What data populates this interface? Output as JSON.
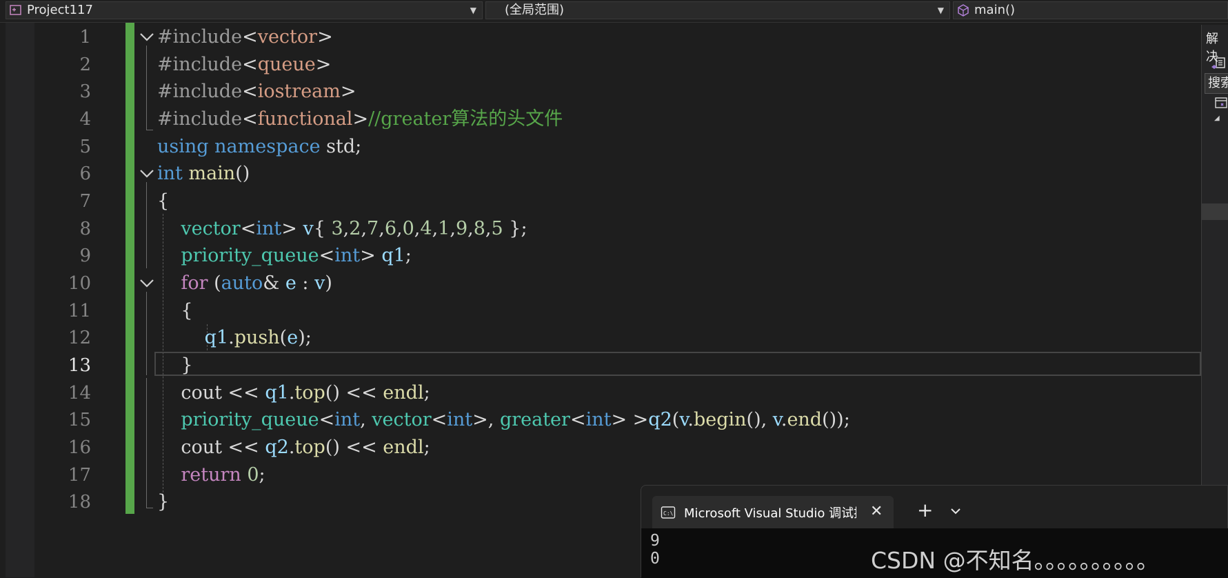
{
  "nav": {
    "project": "Project117",
    "scope": "(全局范围)",
    "member": "main()"
  },
  "editor": {
    "line_numbers": [
      "1",
      "2",
      "3",
      "4",
      "5",
      "6",
      "7",
      "8",
      "9",
      "10",
      "11",
      "12",
      "13",
      "14",
      "15",
      "16",
      "17",
      "18"
    ],
    "current_line": "13"
  },
  "code": [
    [
      [
        "p",
        "#include"
      ],
      [
        "d",
        "<"
      ],
      [
        "s",
        "vector"
      ],
      [
        "d",
        ">"
      ]
    ],
    [
      [
        "p",
        "#include"
      ],
      [
        "d",
        "<"
      ],
      [
        "s",
        "queue"
      ],
      [
        "d",
        ">"
      ]
    ],
    [
      [
        "p",
        "#include"
      ],
      [
        "d",
        "<"
      ],
      [
        "s",
        "iostream"
      ],
      [
        "d",
        ">"
      ]
    ],
    [
      [
        "p",
        "#include"
      ],
      [
        "d",
        "<"
      ],
      [
        "s",
        "functional"
      ],
      [
        "d",
        ">"
      ],
      [
        "m",
        "//greater算法的头文件"
      ]
    ],
    [
      [
        "k",
        "using"
      ],
      [
        "d",
        " "
      ],
      [
        "k",
        "namespace"
      ],
      [
        "d",
        " std;"
      ]
    ],
    [
      [
        "k",
        "int"
      ],
      [
        "d",
        " "
      ],
      [
        "f",
        "main"
      ],
      [
        "d",
        "()"
      ]
    ],
    [
      [
        "d",
        "{"
      ]
    ],
    [
      [
        "d",
        "    "
      ],
      [
        "t",
        "vector"
      ],
      [
        "d",
        "<"
      ],
      [
        "k",
        "int"
      ],
      [
        "d",
        "> "
      ],
      [
        "v",
        "v"
      ],
      [
        "d",
        "{ "
      ],
      [
        "n",
        "3"
      ],
      [
        "d",
        ","
      ],
      [
        "n",
        "2"
      ],
      [
        "d",
        ","
      ],
      [
        "n",
        "7"
      ],
      [
        "d",
        ","
      ],
      [
        "n",
        "6"
      ],
      [
        "d",
        ","
      ],
      [
        "n",
        "0"
      ],
      [
        "d",
        ","
      ],
      [
        "n",
        "4"
      ],
      [
        "d",
        ","
      ],
      [
        "n",
        "1"
      ],
      [
        "d",
        ","
      ],
      [
        "n",
        "9"
      ],
      [
        "d",
        ","
      ],
      [
        "n",
        "8"
      ],
      [
        "d",
        ","
      ],
      [
        "n",
        "5"
      ],
      [
        "d",
        " };"
      ]
    ],
    [
      [
        "d",
        "    "
      ],
      [
        "t",
        "priority_queue"
      ],
      [
        "d",
        "<"
      ],
      [
        "k",
        "int"
      ],
      [
        "d",
        "> "
      ],
      [
        "v",
        "q1"
      ],
      [
        "d",
        ";"
      ]
    ],
    [
      [
        "d",
        "    "
      ],
      [
        "c",
        "for"
      ],
      [
        "d",
        " ("
      ],
      [
        "k",
        "auto"
      ],
      [
        "d",
        "& "
      ],
      [
        "v",
        "e"
      ],
      [
        "d",
        " : "
      ],
      [
        "v",
        "v"
      ],
      [
        "d",
        ")"
      ]
    ],
    [
      [
        "d",
        "    {"
      ]
    ],
    [
      [
        "d",
        "        "
      ],
      [
        "v",
        "q1"
      ],
      [
        "d",
        "."
      ],
      [
        "f",
        "push"
      ],
      [
        "d",
        "("
      ],
      [
        "v",
        "e"
      ],
      [
        "d",
        ");"
      ]
    ],
    [
      [
        "d",
        "    }"
      ]
    ],
    [
      [
        "d",
        "    cout << "
      ],
      [
        "v",
        "q1"
      ],
      [
        "d",
        "."
      ],
      [
        "f",
        "top"
      ],
      [
        "d",
        "() << "
      ],
      [
        "f",
        "endl"
      ],
      [
        "d",
        ";"
      ]
    ],
    [
      [
        "d",
        "    "
      ],
      [
        "t",
        "priority_queue"
      ],
      [
        "d",
        "<"
      ],
      [
        "k",
        "int"
      ],
      [
        "d",
        ", "
      ],
      [
        "t",
        "vector"
      ],
      [
        "d",
        "<"
      ],
      [
        "k",
        "int"
      ],
      [
        "d",
        ">, "
      ],
      [
        "t",
        "greater"
      ],
      [
        "d",
        "<"
      ],
      [
        "k",
        "int"
      ],
      [
        "d",
        "> >"
      ],
      [
        "v",
        "q2"
      ],
      [
        "d",
        "("
      ],
      [
        "v",
        "v"
      ],
      [
        "d",
        "."
      ],
      [
        "f",
        "begin"
      ],
      [
        "d",
        "(), "
      ],
      [
        "v",
        "v"
      ],
      [
        "d",
        "."
      ],
      [
        "f",
        "end"
      ],
      [
        "d",
        "());"
      ]
    ],
    [
      [
        "d",
        "    cout << "
      ],
      [
        "v",
        "q2"
      ],
      [
        "d",
        "."
      ],
      [
        "f",
        "top"
      ],
      [
        "d",
        "() << "
      ],
      [
        "f",
        "endl"
      ],
      [
        "d",
        ";"
      ]
    ],
    [
      [
        "d",
        "    "
      ],
      [
        "c",
        "return"
      ],
      [
        "d",
        " "
      ],
      [
        "n",
        "0"
      ],
      [
        "d",
        ";"
      ]
    ],
    [
      [
        "d",
        "}"
      ]
    ]
  ],
  "right_panel": {
    "title": "解决",
    "search": "搜索"
  },
  "console": {
    "tab_title": "Microsoft Visual Studio 调试控",
    "output": [
      "9",
      "0"
    ]
  },
  "watermark": "CSDN @不知名。。。。。。。。。。"
}
